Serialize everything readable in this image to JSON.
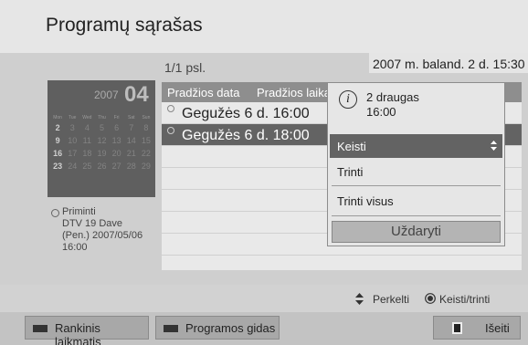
{
  "header": {
    "title": "Programų sąrašas"
  },
  "main": {
    "page_indicator": "1/1 psl.",
    "datetime": "2007 m. baland. 2 d. 15:30"
  },
  "calendar": {
    "year": "2007",
    "month": "04",
    "day_names": [
      "Mon",
      "Tue",
      "Wed",
      "Thu",
      "Fri",
      "Sat",
      "Sun"
    ],
    "dates": [
      "2",
      "3",
      "4",
      "5",
      "6",
      "7",
      "8",
      "9",
      "10",
      "11",
      "12",
      "13",
      "14",
      "15",
      "16",
      "17",
      "18",
      "19",
      "20",
      "21",
      "22",
      "23",
      "24",
      "25",
      "26",
      "27",
      "28",
      "29"
    ],
    "highlighted": [
      "2",
      "9",
      "16",
      "23"
    ]
  },
  "reminder": {
    "lines": [
      "Priminti",
      "DTV 19 Dave",
      "(Pen.) 2007/05/06",
      "16:00"
    ]
  },
  "list": {
    "columns": [
      "Pradžios data",
      "Pradžios laika"
    ],
    "rows": [
      "Gegužės 6 d. 16:00",
      "Gegužės 6 d. 18:00"
    ]
  },
  "popup": {
    "info_glyph": "i",
    "title_lines": [
      "2 draugas",
      "16:00"
    ],
    "items": [
      "Keisti",
      "Trinti",
      "Trinti visus"
    ],
    "close_label": "Uždaryti"
  },
  "hints": {
    "move": "Perkelti",
    "edit": "Keisti/trinti"
  },
  "footer": {
    "manual_timer": "Rankinis laikmatis",
    "program_guide": "Programos gidas",
    "exit": "Išeiti"
  },
  "colors": {
    "header_bg": "#e6e6e6",
    "selection": "#636363",
    "calendar_bg": "#5f5f5f",
    "list_header": "#8e8e8e"
  }
}
